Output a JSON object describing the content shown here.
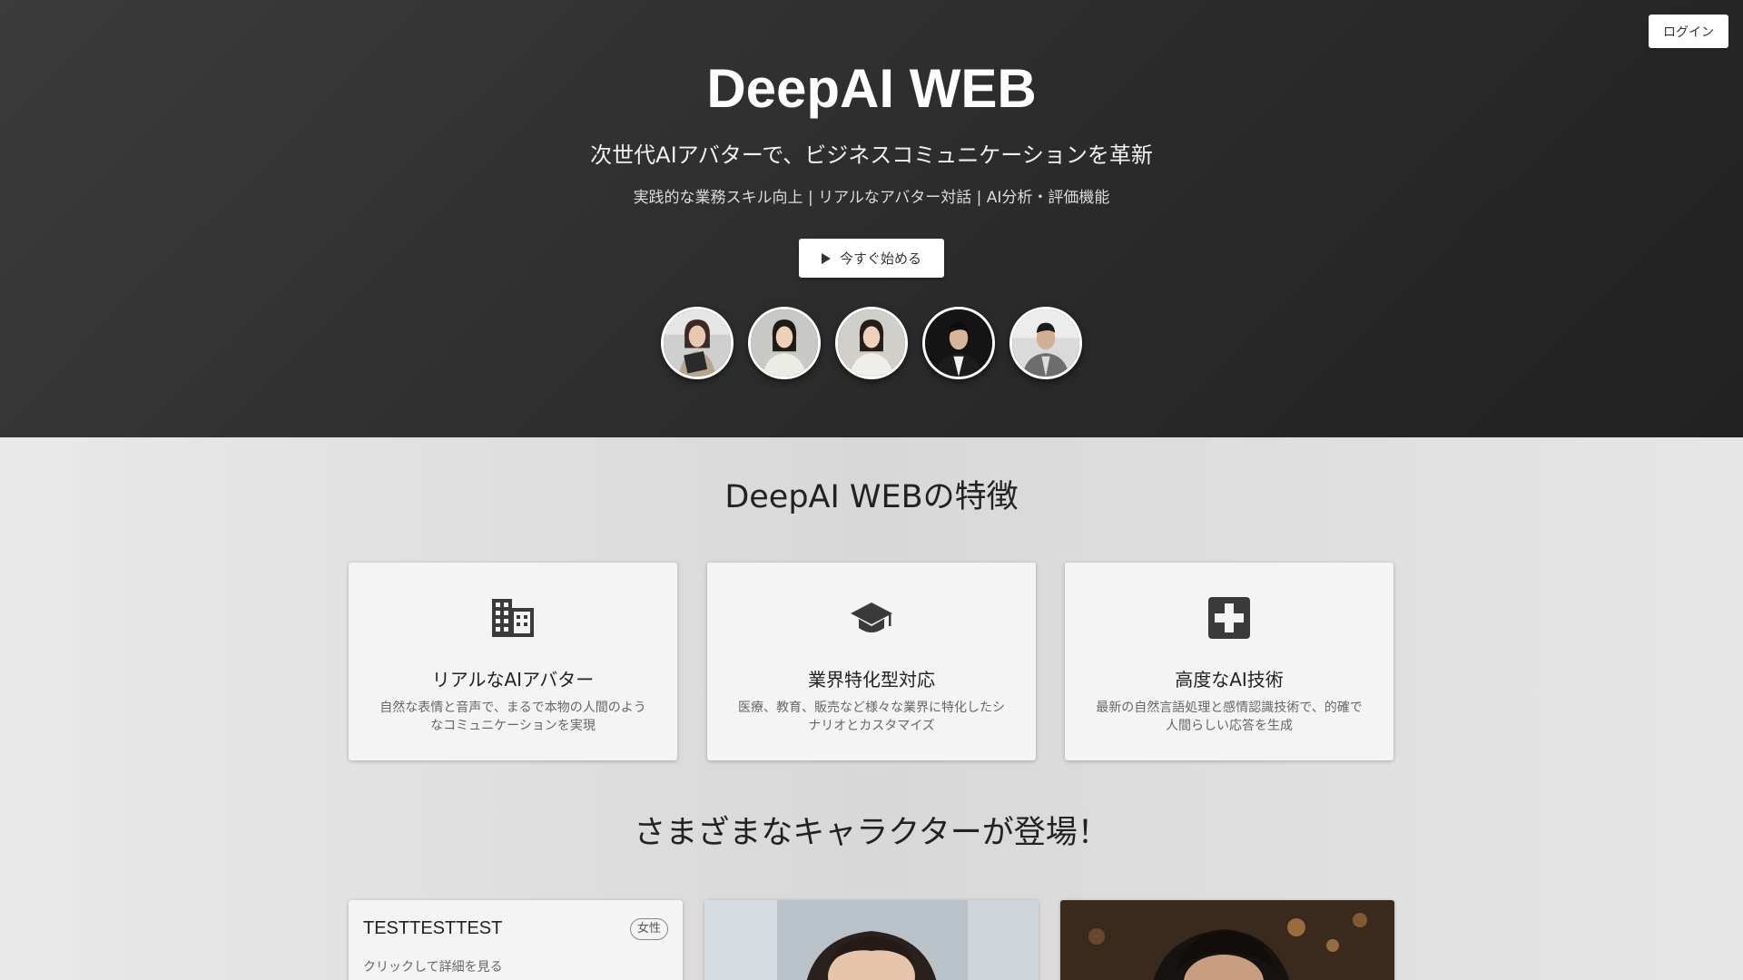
{
  "header": {
    "login_label": "ログイン"
  },
  "hero": {
    "title": "DeepAI WEB",
    "subtitle": "次世代AIアバターで、ビジネスコミュニケーションを革新",
    "tagline": "実践的な業務スキル向上 | リアルなアバター対話 | AI分析・評価機能",
    "cta_label": "今すぐ始める",
    "cta_icon": "play-icon"
  },
  "features": {
    "title": "DeepAI WEBの特徴",
    "items": [
      {
        "icon": "building-icon",
        "name": "リアルなAIアバター",
        "description": "自然な表情と音声で、まるで本物の人間のようなコミュニケーションを実現"
      },
      {
        "icon": "graduation-cap-icon",
        "name": "業界特化型対応",
        "description": "医療、教育、販売など様々な業界に特化したシナリオとカスタマイズ"
      },
      {
        "icon": "medical-cross-icon",
        "name": "高度なAI技術",
        "description": "最新の自然言語処理と感情認識技術で、的確で人間らしい応答を生成"
      }
    ]
  },
  "characters": {
    "title": "さまざまなキャラクターが登場！",
    "cards": [
      {
        "name": "TESTTESTTEST",
        "badge": "女性",
        "hint": "クリックして詳細を見る"
      }
    ]
  },
  "colors": {
    "hero_bg": "#2e2e2e",
    "main_bg": "#dedede",
    "icon_color": "#3a3a3a"
  }
}
